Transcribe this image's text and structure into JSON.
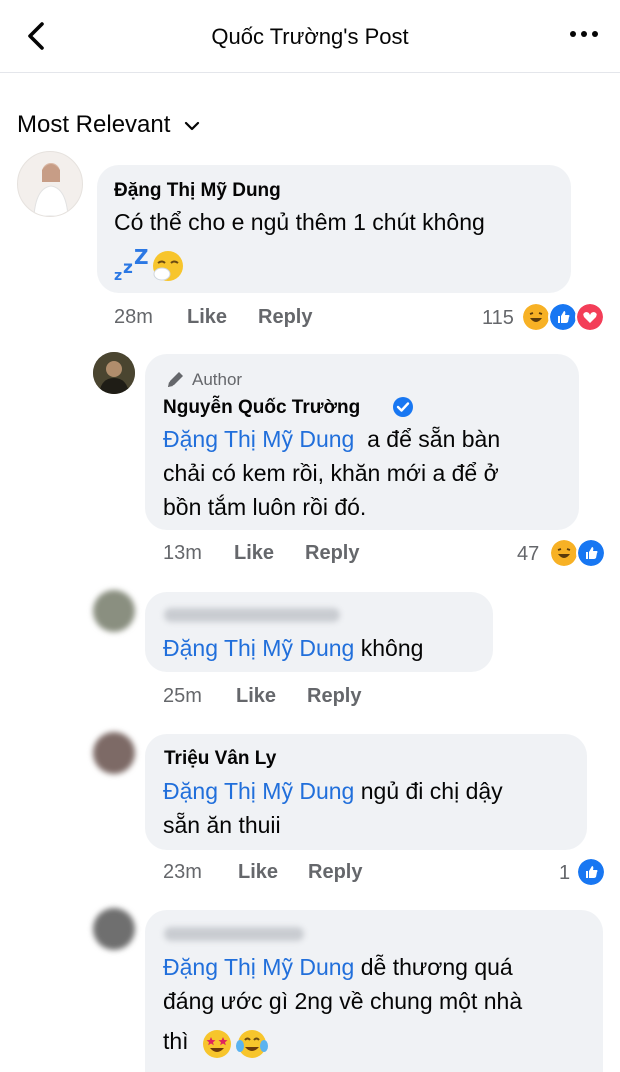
{
  "header": {
    "title": "Quốc Trường's Post"
  },
  "sort": {
    "label": "Most Relevant"
  },
  "comments": [
    {
      "name": "Đặng Thị Mỹ Dung",
      "line1": "Có thể cho e ngủ thêm 1 chút không",
      "time": "28m",
      "like": "Like",
      "reply": "Reply",
      "reaction_count": "115"
    },
    {
      "badge": "Author",
      "name": "Nguyễn Quốc Trường",
      "mention": "Đặng Thị Mỹ Dung",
      "line1_rest": "  a để sẵn bàn",
      "line2": "chải có kem rồi, khăn mới a để ở",
      "line3": "bồn tắm luôn rồi đó.",
      "time": "13m",
      "like": "Like",
      "reply": "Reply",
      "reaction_count": "47"
    },
    {
      "mention": "Đặng Thị Mỹ Dung",
      "line1_rest": " không",
      "time": "25m",
      "like": "Like",
      "reply": "Reply"
    },
    {
      "name": "Triệu Vân Ly",
      "mention": "Đặng Thị Mỹ Dung",
      "line1_rest": " ngủ đi chị dậy",
      "line2": "sẵn ăn thuii",
      "time": "23m",
      "like": "Like",
      "reply": "Reply",
      "reaction_count": "1"
    },
    {
      "mention": "Đặng Thị Mỹ Dung",
      "line1_rest": " dễ thương quá",
      "line2": "đáng ước gì 2ng về chung một nhà",
      "line3": "thì"
    }
  ],
  "colors": {
    "mention": "#216fdb",
    "bubble": "#f0f2f5",
    "like_blue": "#1877f2",
    "love_red": "#f33e58",
    "haha_yellow": "#f7b125"
  }
}
